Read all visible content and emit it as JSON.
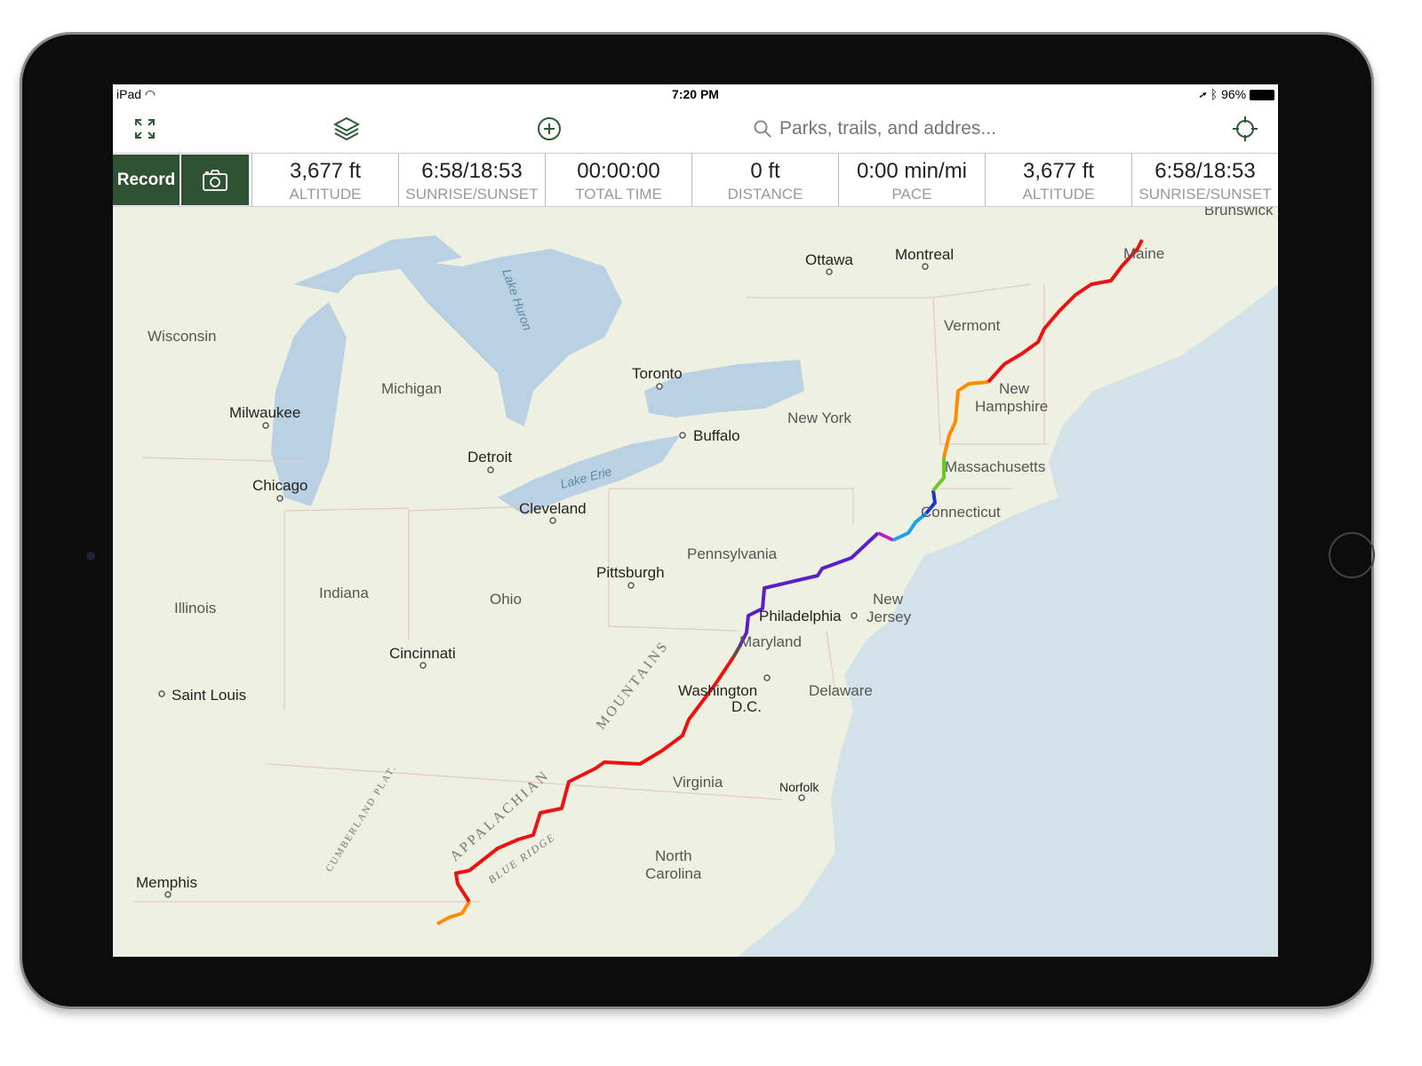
{
  "status_bar": {
    "device": "iPad",
    "time": "7:20 PM",
    "battery": "96%"
  },
  "toolbar": {
    "search_placeholder": "Parks, trails, and addres...",
    "icons": [
      "expand-icon",
      "layers-icon",
      "add-circle-icon",
      "search-icon",
      "locate-crosshair-icon"
    ]
  },
  "record_label": "Record",
  "stats": [
    {
      "value": "3,677 ft",
      "label": "ALTITUDE"
    },
    {
      "value": "6:58/18:53",
      "label": "SUNRISE/SUNSET"
    },
    {
      "value": "00:00:00",
      "label": "TOTAL TIME"
    },
    {
      "value": "0 ft",
      "label": "DISTANCE"
    },
    {
      "value": "0:00 min/mi",
      "label": "PACE"
    },
    {
      "value": "3,677 ft",
      "label": "ALTITUDE"
    },
    {
      "value": "6:58/18:53",
      "label": "SUNRISE/SUNSET"
    }
  ],
  "map": {
    "cities": [
      "Ottawa",
      "Montreal",
      "Toronto",
      "Buffalo",
      "Milwaukee",
      "Chicago",
      "Detroit",
      "Cleveland",
      "Pittsburgh",
      "Philadelphia",
      "Cincinnati",
      "Saint Louis",
      "Washington",
      "D.C.",
      "Norfolk",
      "Memphis"
    ],
    "regions": [
      "Wisconsin",
      "Michigan",
      "New York",
      "Vermont",
      "New",
      "Hampshire",
      "Massachusetts",
      "Connecticut",
      "Pennsylvania",
      "New",
      "Jersey",
      "Maryland",
      "Delaware",
      "Indiana",
      "Ohio",
      "Illinois",
      "Virginia",
      "North",
      "Carolina",
      "Maine",
      "Brunswick"
    ],
    "features": [
      "Lake Huron",
      "Lake Erie",
      "APPALACHIAN",
      "MOUNTAINS",
      "BLUE RIDGE",
      "CUMBERLAND PLAT."
    ],
    "trail_colors": [
      "#ff8c00",
      "#ee1111",
      "#6b4a3a",
      "#5a1fc9",
      "#c020c0",
      "#1aa0f0",
      "#2233cc",
      "#66cc22",
      "#ff8c00",
      "#ee1111"
    ]
  }
}
